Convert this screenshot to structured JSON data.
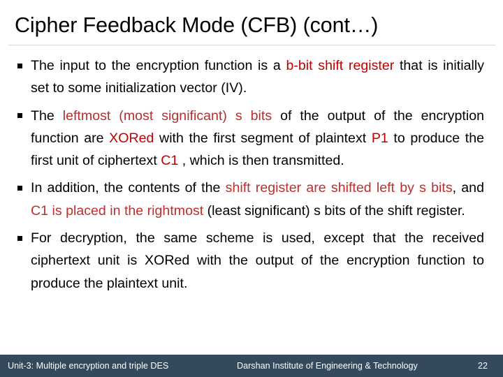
{
  "slide": {
    "title": "Cipher Feedback Mode (CFB) (cont…)",
    "background_color": "#FFFFFF",
    "accent_red": "#C00000",
    "divider_color": "#D9D9D9"
  },
  "bullets": [
    {
      "marker": "square-bullet",
      "runs": [
        {
          "text": "The input to the encryption function is a ",
          "color": "black"
        },
        {
          "text": "b-bit shift register",
          "color": "red"
        },
        {
          "text": " that is initially set to some initialization vector (IV).",
          "color": "black"
        }
      ]
    },
    {
      "marker": "square-bullet",
      "runs": [
        {
          "text": "The ",
          "color": "black"
        },
        {
          "text": "leftmost (most significant) s bits",
          "color": "red-soft"
        },
        {
          "text": " of the output of the encryption function are ",
          "color": "black"
        },
        {
          "text": "XORed",
          "color": "red"
        },
        {
          "text": " with the first segment of plaintext ",
          "color": "black"
        },
        {
          "text": "P1",
          "color": "red"
        },
        {
          "text": " to produce the first unit of ciphertext ",
          "color": "black"
        },
        {
          "text": "C1",
          "color": "red"
        },
        {
          "text": " , which is then transmitted.",
          "color": "black"
        }
      ]
    },
    {
      "marker": "square-bullet",
      "runs": [
        {
          "text": "In addition, the contents of the ",
          "color": "black"
        },
        {
          "text": "shift register are shifted left by s bits",
          "color": "red-mid"
        },
        {
          "text": ", and ",
          "color": "black"
        },
        {
          "text": "C1 is placed in the rightmost",
          "color": "red-mid"
        },
        {
          "text": " (least significant) s bits of the shift register.",
          "color": "black"
        }
      ]
    },
    {
      "marker": "square-bullet",
      "runs": [
        {
          "text": "For decryption, the same scheme is used, except that the received ciphertext unit is XORed with the output of the encryption function to produce the plaintext unit.",
          "color": "black"
        }
      ]
    }
  ],
  "footer": {
    "left": "Unit-3: Multiple encryption and triple DES",
    "center": "Darshan Institute of Engineering & Technology",
    "page_number": "22",
    "bar_color": "#34495C",
    "text_color": "#FFFFFF"
  }
}
